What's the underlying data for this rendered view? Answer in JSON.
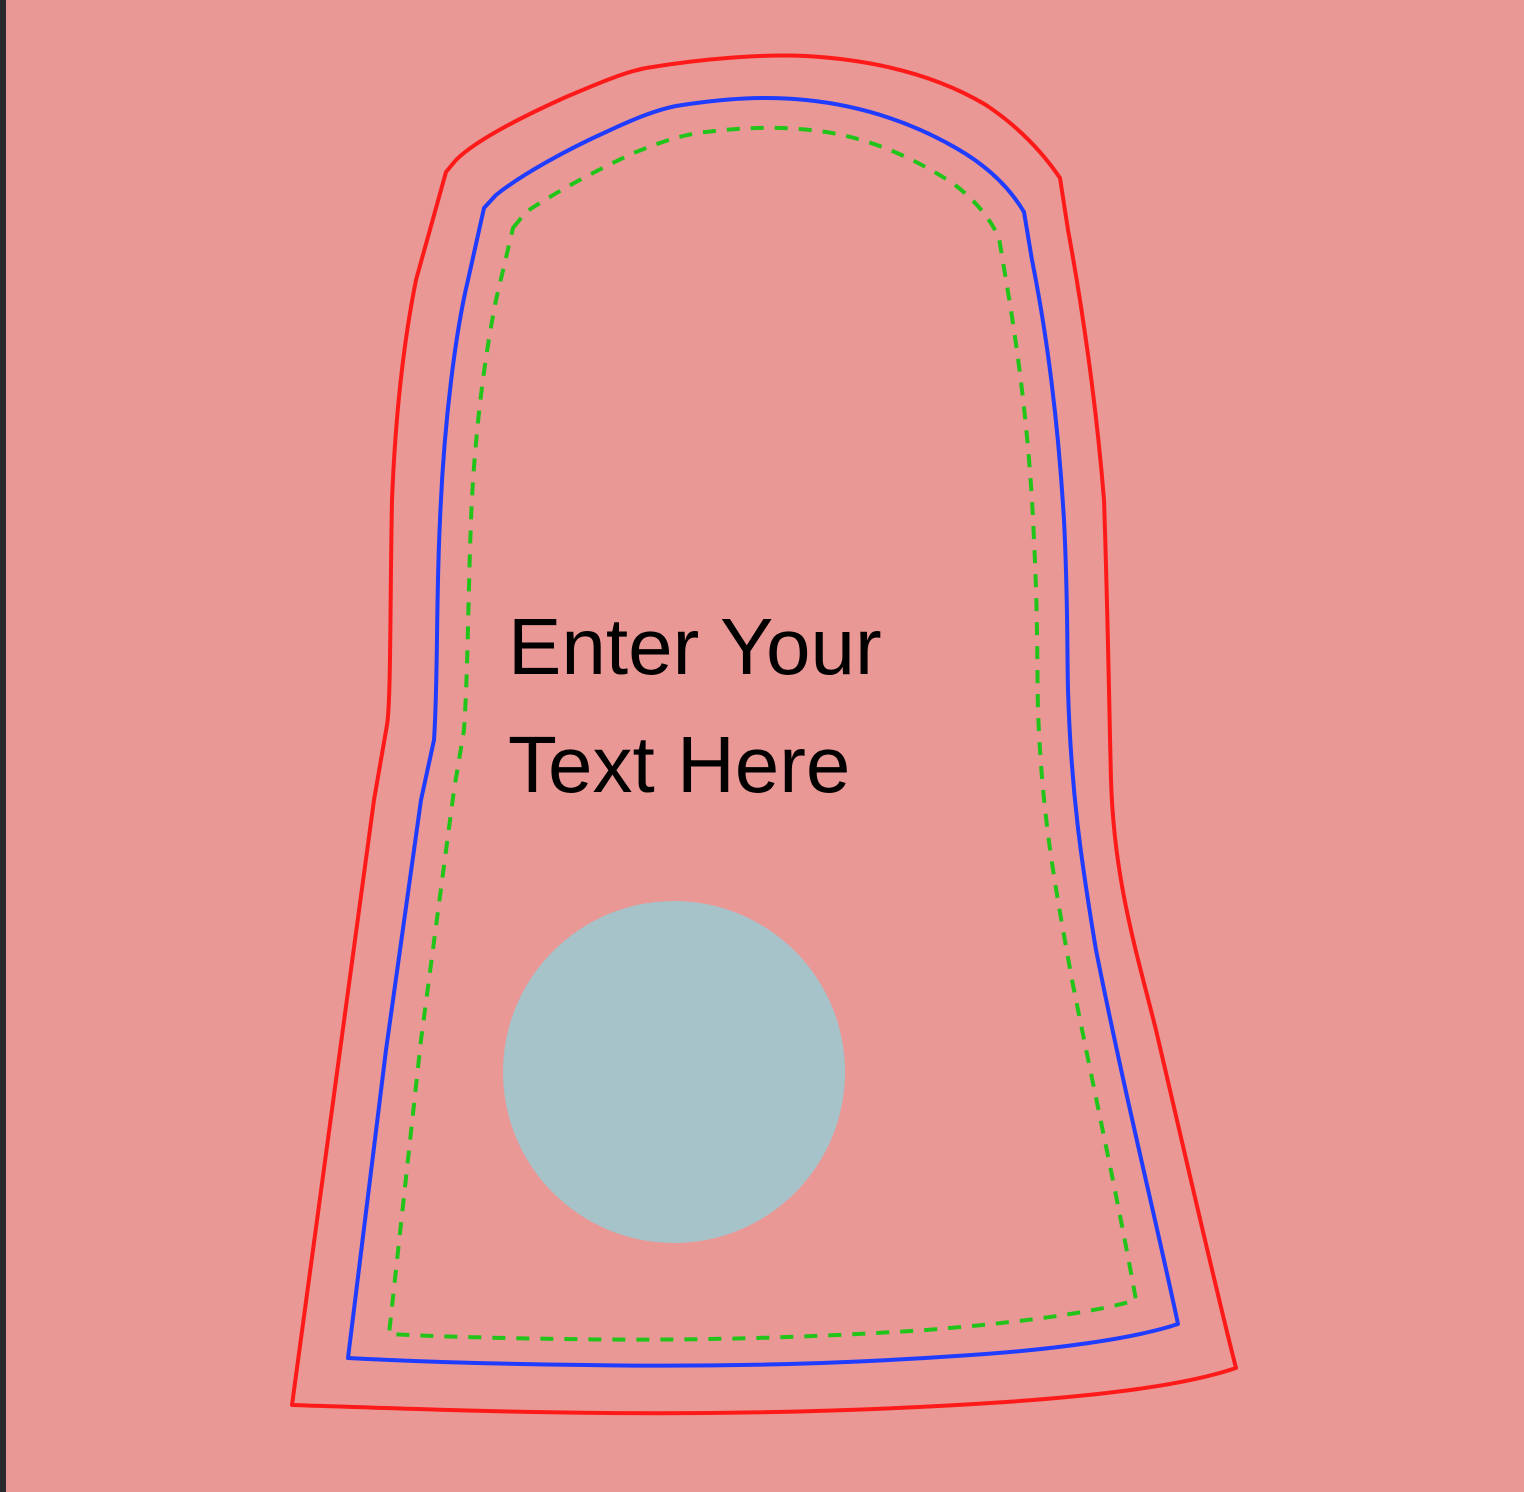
{
  "design": {
    "text_lines": [
      "Enter Your",
      "Text Here"
    ],
    "colors": {
      "background": "#e99896",
      "bleed_line": "#ff1a1a",
      "trim_line": "#1f3cff",
      "safe_line": "#22c41a",
      "circle_fill": "#a6c3c9",
      "text": "#000000",
      "frame": "#2a2a2e"
    }
  }
}
